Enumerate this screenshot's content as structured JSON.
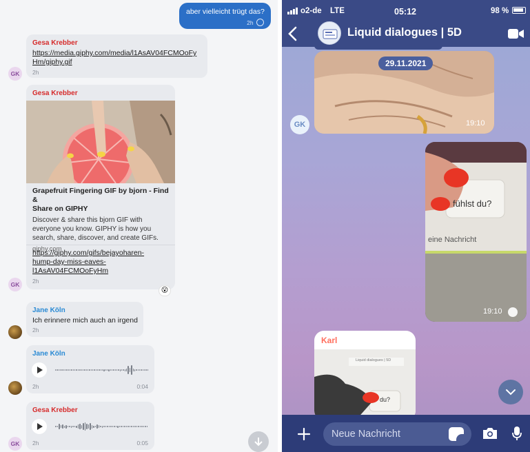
{
  "left": {
    "outgoing": {
      "text": "aber vielleicht trügt das?",
      "time": "2h"
    },
    "msg1": {
      "sender": "Gesa Krebber",
      "link": "https://media.giphy.com/media/l1AsAV04FCMOoFyHm/giphy.gif",
      "link_line1": "https://media.giphy.com/media/l1AsAV04FCMOoFy",
      "link_line2": "Hm/giphy.gif",
      "time": "2h",
      "avatar": "GK"
    },
    "msg2": {
      "sender": "Gesa Krebber",
      "preview_title_1": "Grapefruit Fingering GIF by bjorn - Find &",
      "preview_title_2": "Share on GIPHY",
      "preview_desc_1": "Discover & share this bjorn GIF with",
      "preview_desc_2": "everyone you know. GIPHY is how you",
      "preview_desc_3": "search, share, discover, and create GIFs.",
      "preview_domain": "giphy.com",
      "link_line1": "https://giphy.com/gifs/bejayoharen-",
      "link_line2": "hump-day-miss-eaves-",
      "link_line3": "l1AsAV04FCMOoFyHm",
      "time": "2h",
      "avatar": "GK",
      "reaction": "😮"
    },
    "msg3": {
      "sender": "Jane Köln",
      "text": "Ich erinnere mich auch an irgend",
      "time": "2h"
    },
    "msg4": {
      "sender": "Jane Köln",
      "time": "2h",
      "duration": "0:04"
    },
    "msg5": {
      "sender": "Gesa Krebber",
      "time": "2h",
      "duration": "0:05",
      "avatar": "GK"
    }
  },
  "right": {
    "status": {
      "carrier": "o2-de",
      "network": "LTE",
      "clock": "05:12",
      "battery": "98 %"
    },
    "nav": {
      "title": "Liquid dialogues | 5D",
      "back_icon": "chevron-left-icon",
      "video_icon": "video-camera-icon"
    },
    "date_pill": "29.11.2021",
    "media1_time": "19:10",
    "media1_avatar": "GK",
    "media2": {
      "text_fuehlst": "fühlst du?",
      "text_nachricht": "eine Nachricht",
      "time": "19:10"
    },
    "karl": {
      "sender": "Karl",
      "inner_title": "Liquid dialogues | 5D",
      "inner_text": "du?"
    },
    "composer": {
      "placeholder": "Neue Nachricht"
    },
    "colors": {
      "header": "#3a4a86",
      "composer": "#2d3c78",
      "outgoing_left": "#2b6fc7",
      "sender_red": "#d62b2b",
      "sender_blue": "#2a8ad4",
      "karl": "#ff6f5e"
    }
  }
}
